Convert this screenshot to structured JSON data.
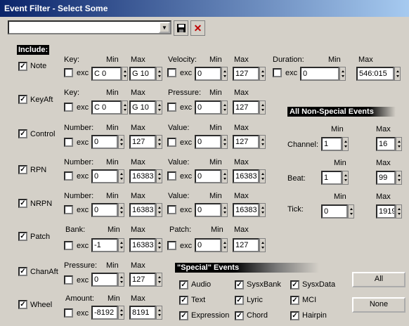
{
  "window": {
    "title": "Event Filter - Select Some"
  },
  "toolbar": {
    "preset_value": "",
    "save_icon": "floppy-disk-icon",
    "delete_icon": "red-x-icon"
  },
  "include_label": "Include:",
  "exc_label": "exc",
  "min_label": "Min",
  "max_label": "Max",
  "events": {
    "note": {
      "label": "Note",
      "checked": true,
      "key": {
        "label": "Key:",
        "exc": false,
        "min": "C 0",
        "max": "G 10"
      },
      "velocity": {
        "label": "Velocity:",
        "exc": false,
        "min": "0",
        "max": "127"
      },
      "duration": {
        "label": "Duration:",
        "exc": false,
        "min": "0",
        "max": "546:015"
      }
    },
    "keyaft": {
      "label": "KeyAft",
      "checked": true,
      "key": {
        "label": "Key:",
        "exc": false,
        "min": "C 0",
        "max": "G 10"
      },
      "pressure": {
        "label": "Pressure:",
        "exc": false,
        "min": "0",
        "max": "127"
      }
    },
    "control": {
      "label": "Control",
      "checked": true,
      "number": {
        "label": "Number:",
        "exc": false,
        "min": "0",
        "max": "127"
      },
      "value": {
        "label": "Value:",
        "exc": false,
        "min": "0",
        "max": "127"
      }
    },
    "rpn": {
      "label": "RPN",
      "checked": true,
      "number": {
        "label": "Number:",
        "exc": false,
        "min": "0",
        "max": "16383"
      },
      "value": {
        "label": "Value:",
        "exc": false,
        "min": "0",
        "max": "16383"
      }
    },
    "nrpn": {
      "label": "NRPN",
      "checked": true,
      "number": {
        "label": "Number:",
        "exc": false,
        "min": "0",
        "max": "16383"
      },
      "value": {
        "label": "Value:",
        "exc": false,
        "min": "0",
        "max": "16383"
      }
    },
    "patch": {
      "label": "Patch",
      "checked": true,
      "bank": {
        "label": "Bank:",
        "exc": false,
        "min": "-1",
        "max": "16383"
      },
      "patch": {
        "label": "Patch:",
        "exc": false,
        "min": "0",
        "max": "127"
      }
    },
    "chanaft": {
      "label": "ChanAft",
      "checked": true,
      "pressure": {
        "label": "Pressure:",
        "exc": false,
        "min": "0",
        "max": "127"
      }
    },
    "wheel": {
      "label": "Wheel",
      "checked": true,
      "amount": {
        "label": "Amount:",
        "exc": false,
        "min": "-8192",
        "max": "8191"
      }
    }
  },
  "non_special": {
    "header": "All Non-Special Events",
    "channel": {
      "label": "Channel:",
      "min": "1",
      "max": "16"
    },
    "beat": {
      "label": "Beat:",
      "min": "1",
      "max": "99"
    },
    "tick": {
      "label": "Tick:",
      "min": "0",
      "max": "1919"
    }
  },
  "special": {
    "header": "\"Special\" Events",
    "items": [
      {
        "label": "Audio",
        "checked": true
      },
      {
        "label": "SysxBank",
        "checked": true
      },
      {
        "label": "SysxData",
        "checked": true
      },
      {
        "label": "Text",
        "checked": true
      },
      {
        "label": "Lyric",
        "checked": true
      },
      {
        "label": "MCI",
        "checked": true
      },
      {
        "label": "Expression",
        "checked": true
      },
      {
        "label": "Chord",
        "checked": true
      },
      {
        "label": "Hairpin",
        "checked": true
      }
    ]
  },
  "buttons": {
    "all": "All",
    "none": "None"
  }
}
